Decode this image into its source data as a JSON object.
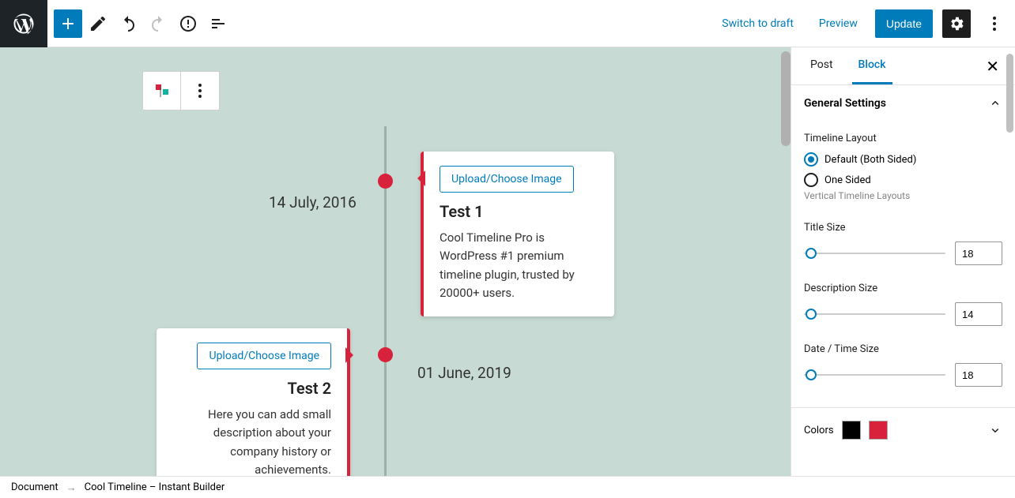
{
  "topbar": {
    "switch_draft": "Switch to draft",
    "preview": "Preview",
    "update": "Update"
  },
  "timeline": {
    "items": [
      {
        "date": "14 July, 2016",
        "title": "Test 1",
        "upload_label": "Upload/Choose Image",
        "description": "Cool Timeline Pro is WordPress #1 premium timeline plugin, trusted by 20000+ users."
      },
      {
        "date": "01 June, 2019",
        "title": "Test 2",
        "upload_label": "Upload/Choose Image",
        "description": "Here you can add small description about your company history or achievements."
      }
    ]
  },
  "sidebar": {
    "tabs": {
      "post": "Post",
      "block": "Block"
    },
    "general_settings": "General Settings",
    "layout": {
      "label": "Timeline Layout",
      "opt_default": "Default (Both Sided)",
      "opt_one_sided": "One Sided",
      "hint": "Vertical Timeline Layouts"
    },
    "title_size": {
      "label": "Title Size",
      "value": "18"
    },
    "desc_size": {
      "label": "Description Size",
      "value": "14"
    },
    "date_size": {
      "label": "Date / Time Size",
      "value": "18"
    },
    "colors_label": "Colors",
    "colors": {
      "primary": "#000000",
      "secondary": "#d8213b"
    }
  },
  "breadcrumb": {
    "document": "Document",
    "item": "Cool Timeline – Instant Builder"
  }
}
